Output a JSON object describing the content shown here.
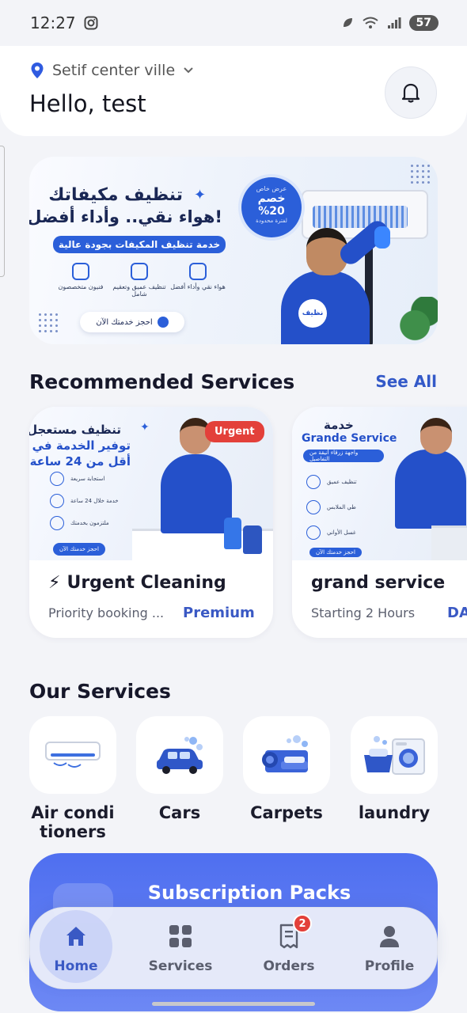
{
  "status_bar": {
    "time": "12:27",
    "battery": "57"
  },
  "header": {
    "location": "Setif center ville",
    "greeting": "Hello, test"
  },
  "banner": {
    "title_line1": "تنظيف مكيفاتك",
    "title_line2": "هواء نقي.. وأداء أفضل!",
    "ribbon": "خدمة تنظيف المكيفات بجودة عالية",
    "features": [
      "هواء نقي وأداء أفضل",
      "تنظيف عميق وتعقيم شامل",
      "فنيون متخصصون"
    ],
    "cta": "احجز خدمتك الآن",
    "discount_line1": "عرض خاص",
    "discount_line2": "خصم",
    "discount_line3": "%20",
    "discount_line4": "لفترة محدودة",
    "logo": "نظيف"
  },
  "recommended": {
    "title": "Recommended Services",
    "see_all": "See All",
    "cards": [
      {
        "name": "Urgent Cleaning",
        "emoji": "⚡",
        "subtitle": "Priority booking ...",
        "tag": "Premium",
        "badge": "Urgent",
        "img_title1": "تنظيف مستعجل",
        "img_title2": "توفير الخدمة في",
        "img_title3": "أقل من 24 ساعة",
        "img_rows": [
          "استجابة سريعة",
          "خدمة خلال 24 ساعة",
          "ملتزمون بخدمتك"
        ],
        "img_cta": "احجز خدمتك الآن"
      },
      {
        "name": "grand service",
        "subtitle": "Starting 2 Hours",
        "tag": "DA",
        "img_title1": "خدمة",
        "img_title2": "Grande Service",
        "img_ribbon": "واجهة زرقاء أنيقة من التفاصيل",
        "img_rows": [
          "تنظيف عميق",
          "طي الملابس",
          "غسل الأواني"
        ],
        "img_cta": "احجز خدمتك الآن"
      }
    ]
  },
  "our_services": {
    "title": "Our Services",
    "items": [
      {
        "label": "Air condi tioners",
        "icon": "air-conditioner-icon"
      },
      {
        "label": "Cars",
        "icon": "car-icon"
      },
      {
        "label": "Carpets",
        "icon": "carpet-icon"
      },
      {
        "label": "laundry",
        "icon": "washing-machine-icon"
      }
    ]
  },
  "subscription": {
    "title": "Subscription Packs"
  },
  "bottom_nav": {
    "items": [
      {
        "label": "Home",
        "icon": "home-icon",
        "active": true
      },
      {
        "label": "Services",
        "icon": "grid-icon"
      },
      {
        "label": "Orders",
        "icon": "receipt-icon",
        "badge": "2"
      },
      {
        "label": "Profile",
        "icon": "person-icon"
      }
    ]
  },
  "colors": {
    "accent": "#3a59c4",
    "banner_blue": "#2b5fd9",
    "urgent_red": "#e3403a",
    "subscription": "#4f6ff0"
  }
}
